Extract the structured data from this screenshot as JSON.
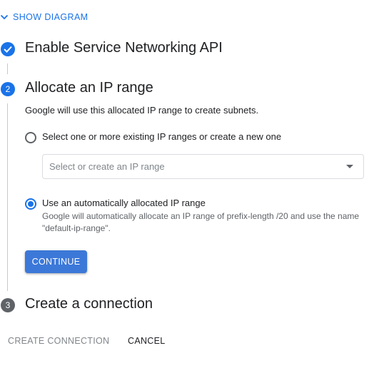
{
  "show_diagram": {
    "label": "SHOW DIAGRAM",
    "icon": "chevron-down-icon"
  },
  "steps": [
    {
      "number": "1",
      "title": "Enable Service Networking API",
      "state": "done"
    },
    {
      "number": "2",
      "title": "Allocate an IP range",
      "state": "active",
      "description": "Google will use this allocated IP range to create subnets.",
      "options": [
        {
          "label": "Select one or more existing IP ranges or create a new one",
          "checked": false
        },
        {
          "label": "Use an automatically allocated IP range",
          "checked": true,
          "help": "Google will automatically allocate an IP range of prefix-length /20 and use the name \"default-ip-range\"."
        }
      ],
      "select_placeholder": "Select or create an IP range",
      "continue_label": "CONTINUE"
    },
    {
      "number": "3",
      "title": "Create a connection",
      "state": "pending"
    }
  ],
  "footer": {
    "create_label": "CREATE CONNECTION",
    "cancel_label": "CANCEL"
  },
  "colors": {
    "accent": "#1a73e8",
    "primary_button": "#3c78d8",
    "pending_step": "#5f6368"
  }
}
